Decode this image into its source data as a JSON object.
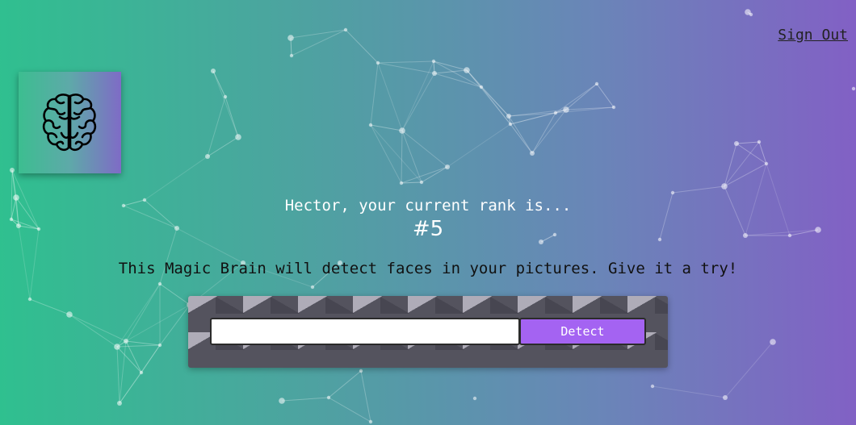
{
  "nav": {
    "sign_out_label": "Sign Out"
  },
  "logo": {
    "icon": "brain-icon"
  },
  "rank": {
    "message": "Hector, your current rank is...",
    "number": "#5"
  },
  "main": {
    "tagline": "This Magic Brain will detect faces in your pictures. Give it a try!"
  },
  "form": {
    "input_value": "",
    "placeholder": "",
    "detect_label": "Detect"
  },
  "colors": {
    "gradient_start": "#2fc08f",
    "gradient_end": "#8260c5",
    "button": "#a463f2"
  }
}
